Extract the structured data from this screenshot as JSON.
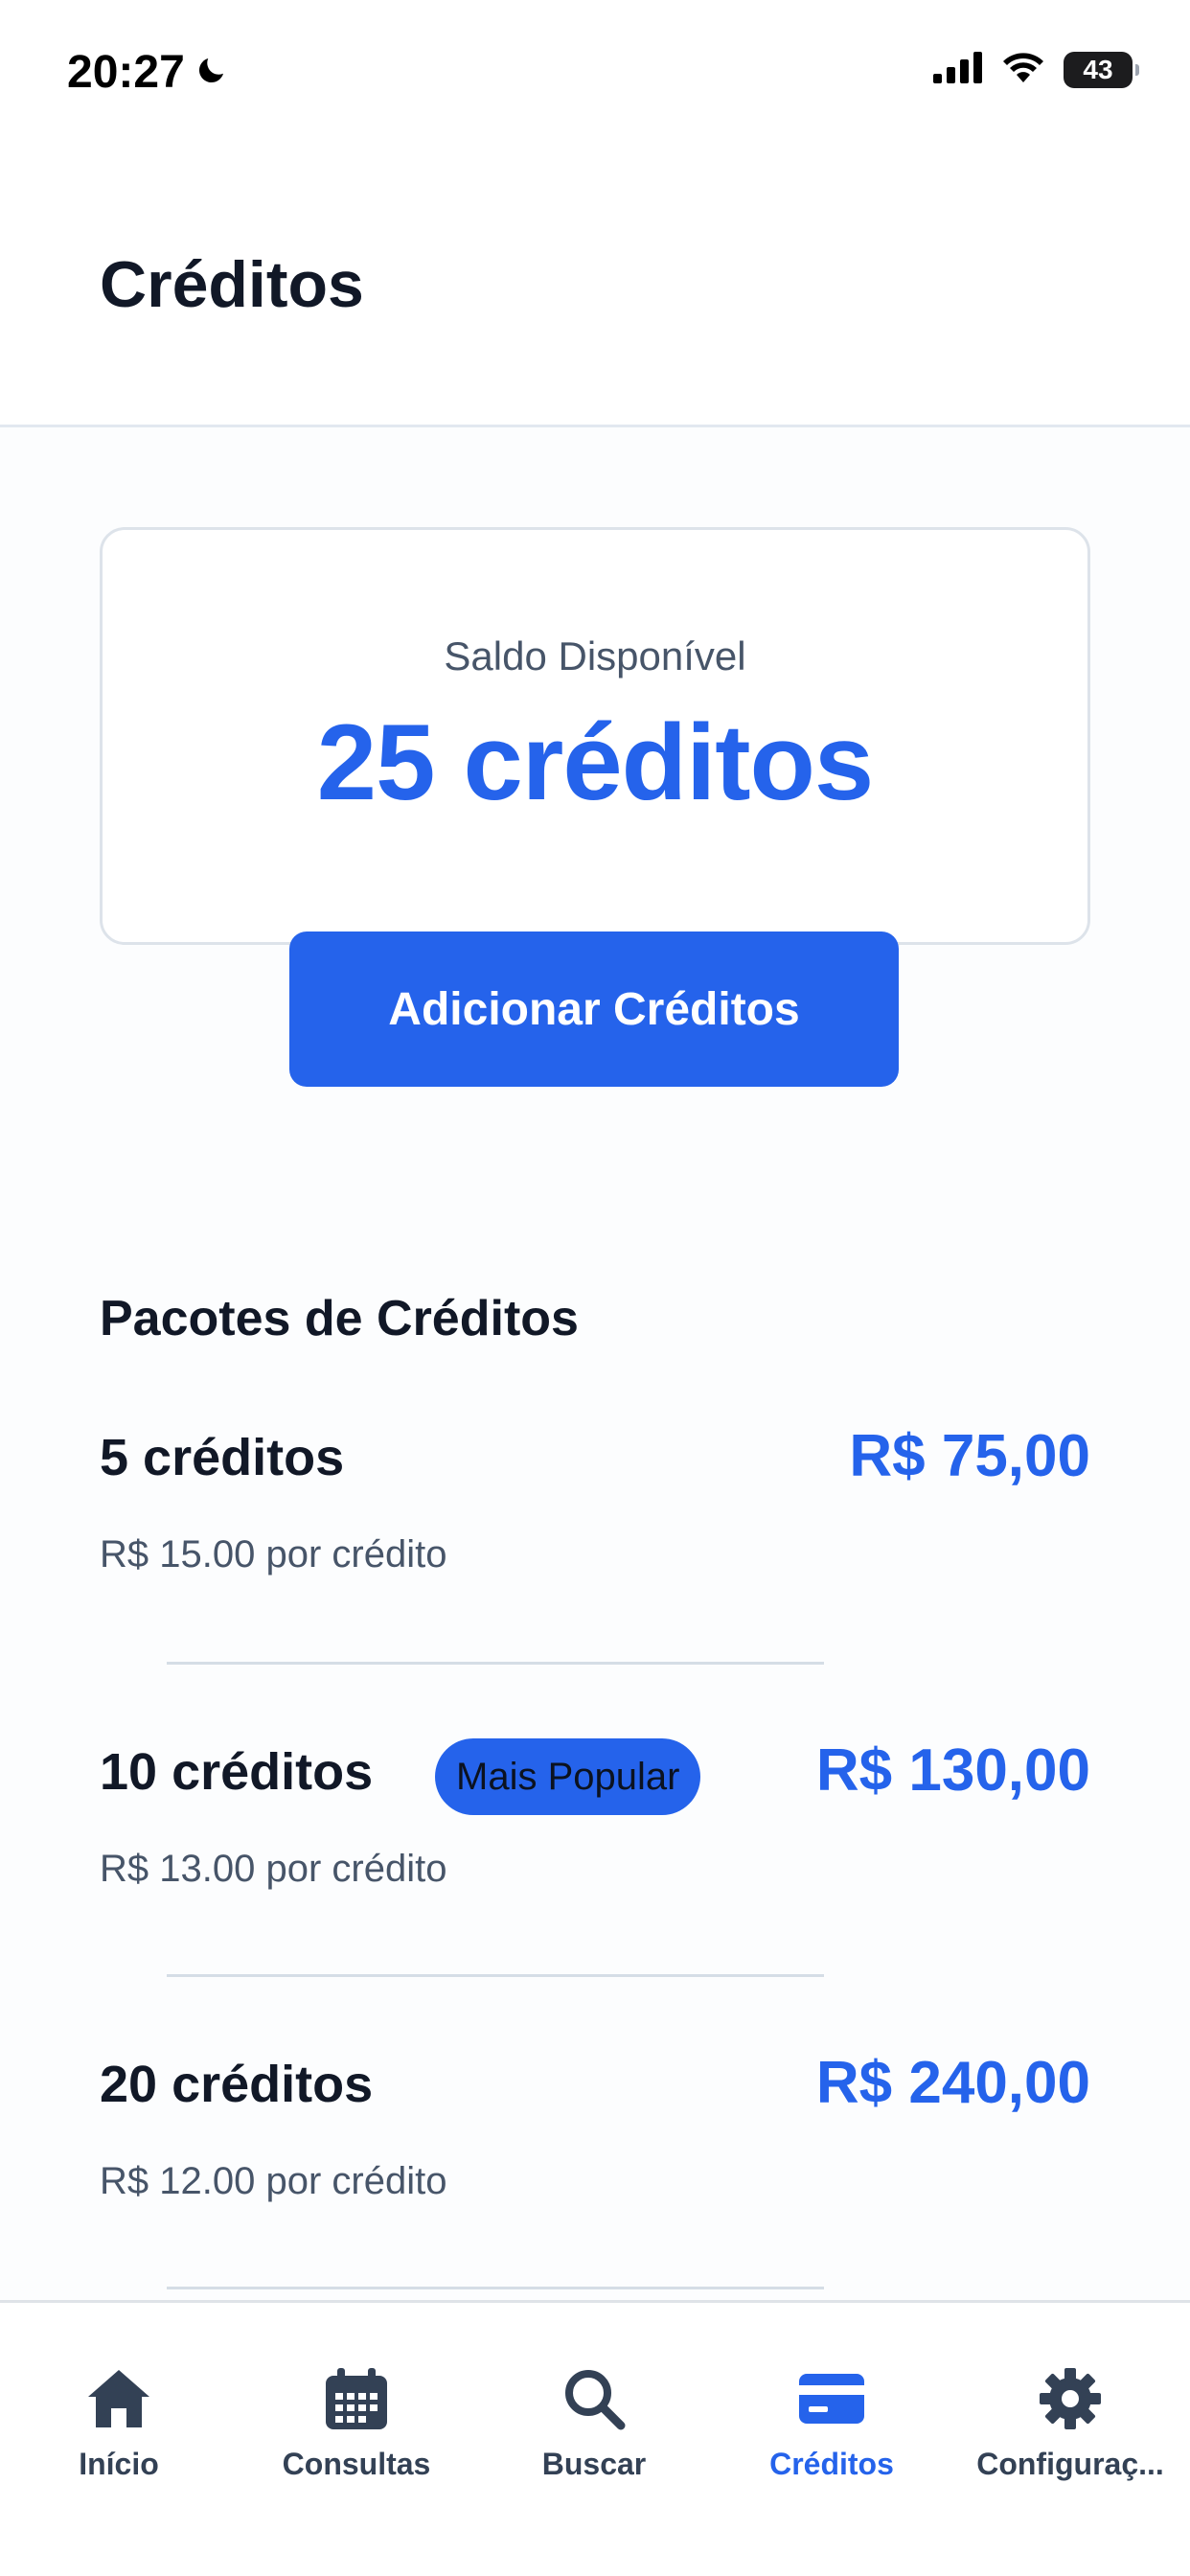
{
  "status_bar": {
    "time": "20:27",
    "battery": "43"
  },
  "header": {
    "title": "Créditos"
  },
  "balance": {
    "label": "Saldo Disponível",
    "value": "25 créditos",
    "add_button": "Adicionar Créditos"
  },
  "packages": {
    "title": "Pacotes de Créditos",
    "items": [
      {
        "name": "5 créditos",
        "price": "R$ 75,00",
        "unit": "R$ 15.00 por crédito"
      },
      {
        "name": "10 créditos",
        "price": "R$ 130,00",
        "unit": "R$ 13.00 por crédito",
        "badge": "Mais Popular"
      },
      {
        "name": "20 créditos",
        "price": "R$ 240,00",
        "unit": "R$ 12.00 por crédito"
      }
    ]
  },
  "tabs": [
    {
      "label": "Início",
      "icon": "home-icon"
    },
    {
      "label": "Consultas",
      "icon": "calendar-icon"
    },
    {
      "label": "Buscar",
      "icon": "search-icon"
    },
    {
      "label": "Créditos",
      "icon": "credit-card-icon",
      "active": true
    },
    {
      "label": "Configuraç...",
      "icon": "gear-icon"
    }
  ],
  "colors": {
    "accent": "#2563eb",
    "text": "#111827",
    "muted": "#475569",
    "tab_inactive": "#334155"
  }
}
